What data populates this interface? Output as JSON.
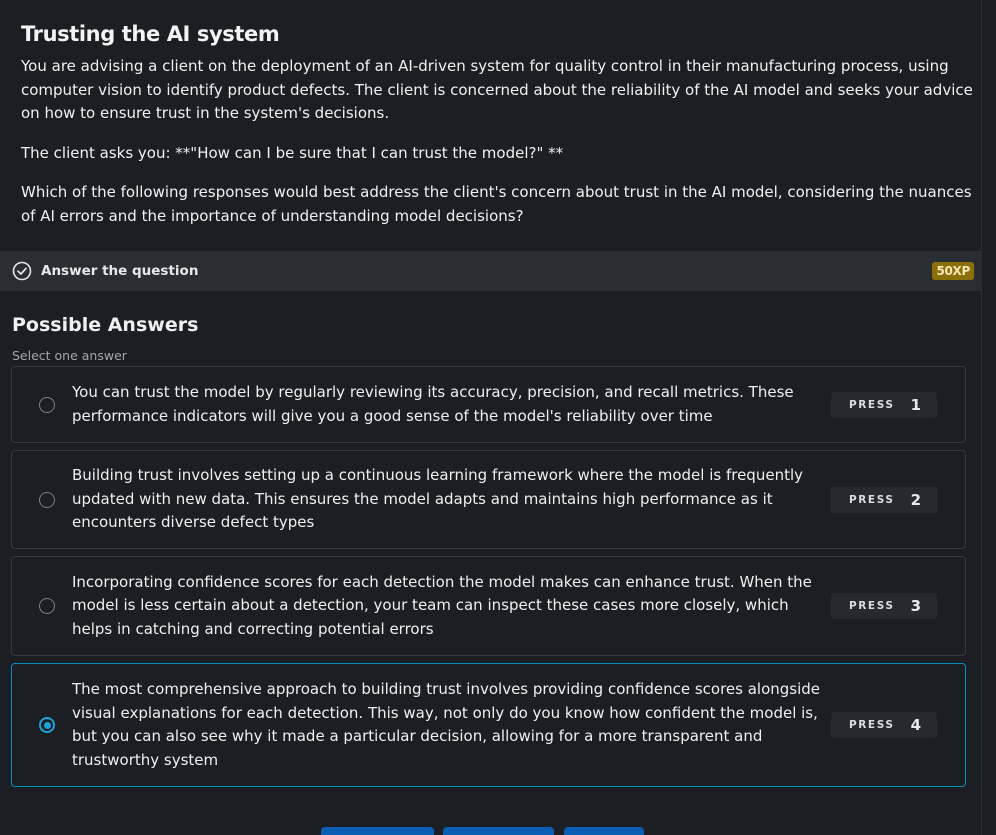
{
  "exercise": {
    "title": "Trusting the AI system",
    "paragraphs": [
      "You are advising a client on the deployment of an AI-driven system for quality control in their manufacturing process, using computer vision to identify product defects. The client is concerned about the reliability of the AI model and seeks your advice on how to ensure trust in the system's decisions.",
      "The client asks you: **\"How can I be sure that I can trust the model?\" **",
      "Which of the following responses would best address the client's concern about trust in the AI model, considering the nuances of AI errors and the importance of understanding model decisions?"
    ]
  },
  "task_bar": {
    "label": "Answer the question",
    "xp": "50XP"
  },
  "answers": {
    "title": "Possible Answers",
    "subtitle": "Select one answer",
    "selected_index": 3,
    "options": [
      {
        "text": "You can trust the model by regularly reviewing its accuracy, precision, and recall metrics. These performance indicators will give you a good sense of the model's reliability over time",
        "press_label": "PRESS",
        "key": "1"
      },
      {
        "text": "Building trust involves setting up a continuous learning framework where the model is frequently updated with new data. This ensures the model adapts and maintains high performance as it encounters diverse defect types",
        "press_label": "PRESS",
        "key": "2"
      },
      {
        "text": "Incorporating confidence scores for each detection the model makes can enhance trust. When the model is less certain about a detection, your team can inspect these cases more closely, which helps in catching and correcting potential errors",
        "press_label": "PRESS",
        "key": "3"
      },
      {
        "text": "The most comprehensive approach to building trust involves providing confidence scores alongside visual explanations for each detection. This way, not only do you know how confident the model is, but you can also see why it made a particular decision, allowing for a more transparent and trustworthy system",
        "press_label": "PRESS",
        "key": "4"
      }
    ]
  },
  "colors": {
    "background": "#1b1e22",
    "selected_accent": "#1aa3dc",
    "xp_badge": "#8a6f0b",
    "primary_button": "#0a5eb3"
  }
}
